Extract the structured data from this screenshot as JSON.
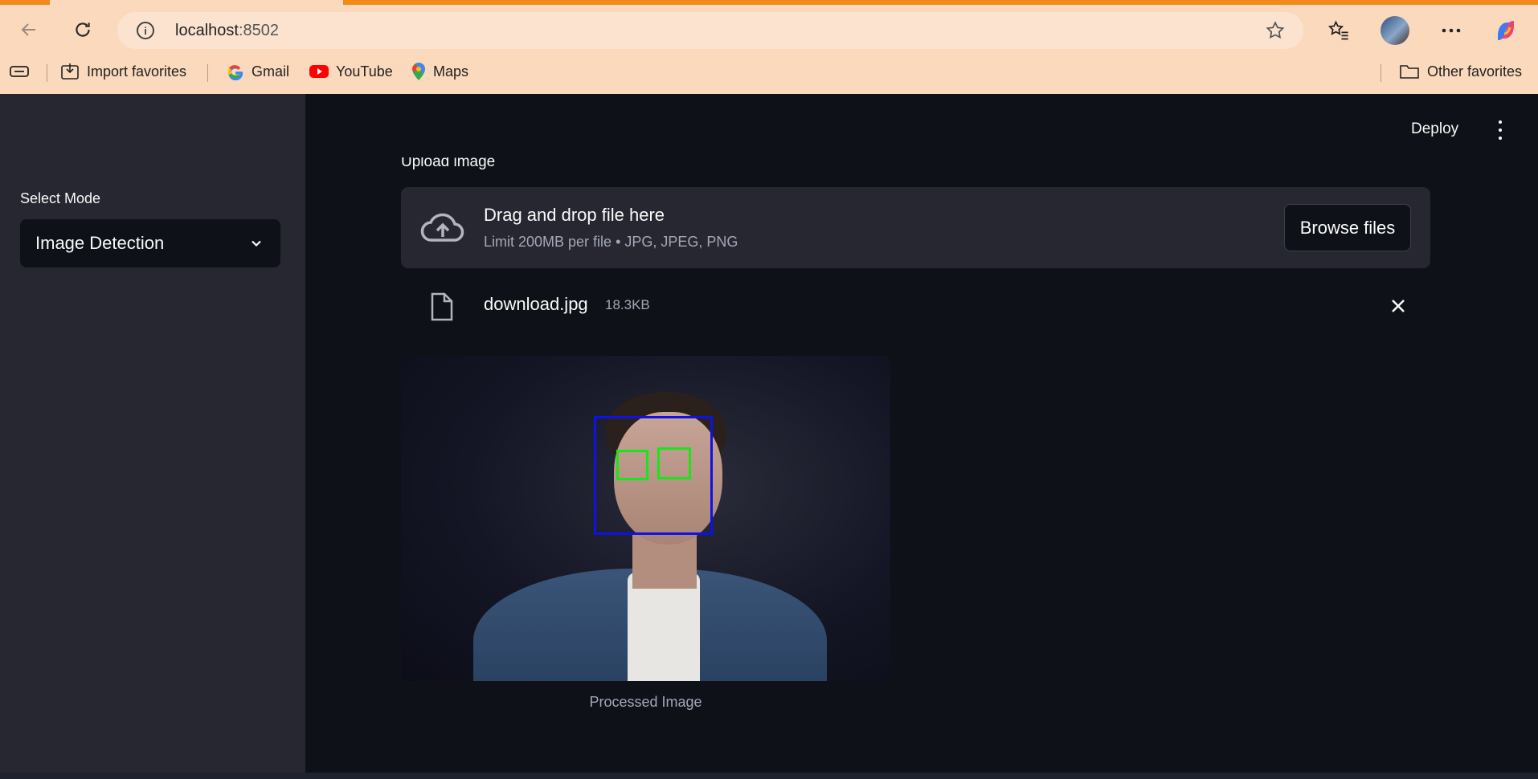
{
  "browser": {
    "url_host": "localhost",
    "url_port": ":8502",
    "bookmarks": [
      {
        "label": "Import favorites",
        "icon": "import-icon"
      },
      {
        "label": "Gmail",
        "icon": "google-icon"
      },
      {
        "label": "YouTube",
        "icon": "youtube-icon"
      },
      {
        "label": "Maps",
        "icon": "maps-icon"
      }
    ],
    "other_favorites": "Other favorites"
  },
  "sidebar": {
    "select_label": "Select Mode",
    "select_value": "Image Detection"
  },
  "header": {
    "deploy_label": "Deploy"
  },
  "uploader": {
    "label": "Upload image",
    "title": "Drag and drop file here",
    "subtitle": "Limit 200MB per file • JPG, JPEG, PNG",
    "browse_label": "Browse files"
  },
  "file": {
    "name": "download.jpg",
    "size": "18.3KB"
  },
  "image": {
    "caption": "Processed Image",
    "face_box_color": "#1010e8",
    "eye_box_color": "#19e619"
  },
  "colors": {
    "browser_bg": "#fbd9bd",
    "sidebar_bg": "#262730",
    "main_bg": "#0e1117",
    "text": "#fafafa"
  }
}
